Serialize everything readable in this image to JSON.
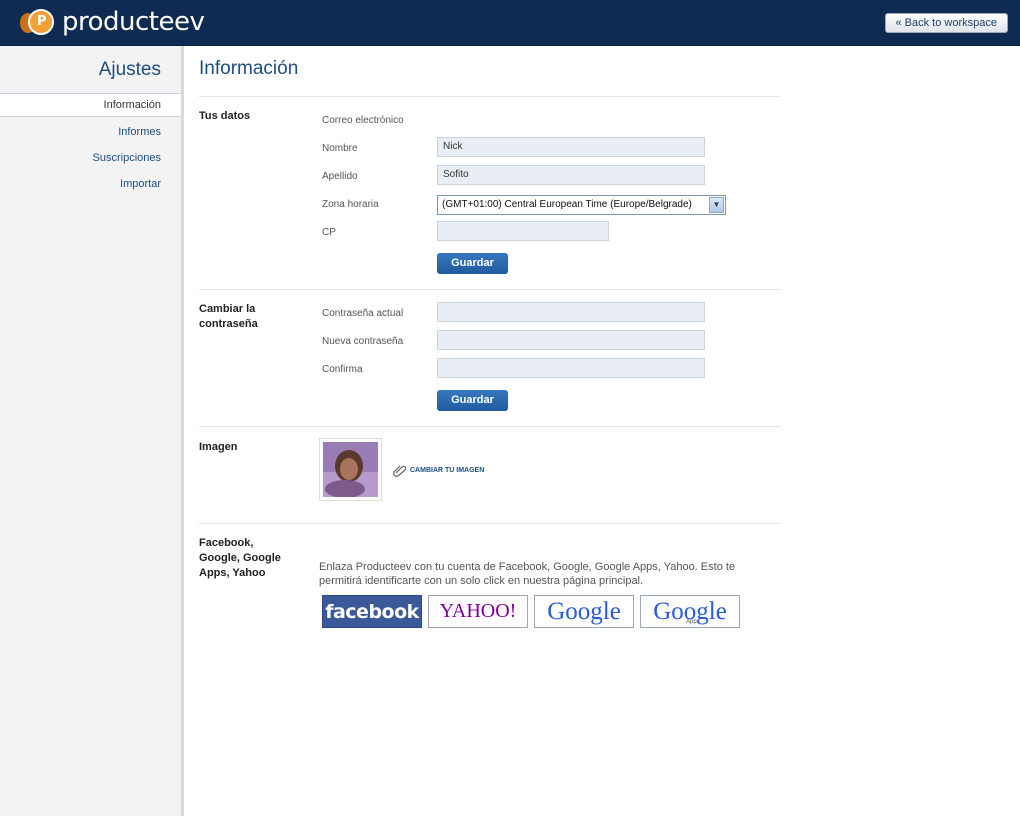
{
  "header": {
    "logo_text": "producteev",
    "logo_mark": "P",
    "back_label": "« Back to workspace"
  },
  "sidebar": {
    "title": "Ajustes",
    "items": [
      {
        "label": "Información",
        "active": true
      },
      {
        "label": "Informes"
      },
      {
        "label": "Suscripciones"
      },
      {
        "label": "Importar"
      }
    ]
  },
  "main": {
    "title": "Información",
    "datos": {
      "section": "Tus datos",
      "email_label": "Correo electrónico",
      "email_value": "",
      "nombre_label": "Nombre",
      "nombre_value": "Nick",
      "apellido_label": "Apellido",
      "apellido_value": "Sofito",
      "zona_label": "Zona horaria",
      "zona_value": "(GMT+01:00) Central European Time (Europe/Belgrade)",
      "cp_label": "CP",
      "cp_value": "",
      "save_label": "Guardar"
    },
    "password": {
      "section": "Cambiar la contraseña",
      "actual_label": "Contraseña actual",
      "nueva_label": "Nueva contraseña",
      "confirma_label": "Confirma",
      "save_label": "Guardar"
    },
    "imagen": {
      "section": "Imagen",
      "change_label": "CAMBIAR TU IMAGEN"
    },
    "social": {
      "section": "Facebook, Google, Google Apps, Yahoo",
      "description": "Enlaza Producteev con tu cuenta de Facebook, Google, Google Apps, Yahoo. Esto te permitirá identificarte con un solo click en nuestra página principal.",
      "facebook_label": "facebook",
      "yahoo_label": "YAHOO!",
      "google_label": "Google",
      "google_apps_label": "Google",
      "google_apps_sub": "Apps"
    }
  }
}
